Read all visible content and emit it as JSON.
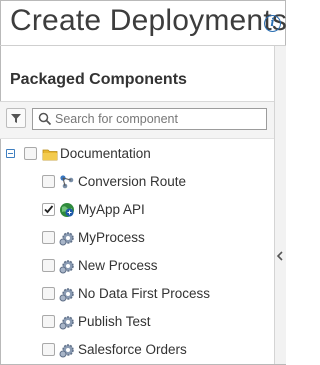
{
  "header": {
    "title": "Create Deployments",
    "info_icon": "info-icon"
  },
  "panel": {
    "section_title": "Packaged Components",
    "search": {
      "placeholder": "Search for component",
      "value": ""
    },
    "filter_icon": "filter-icon",
    "search_icon": "search-icon",
    "collapse_icon": "chevron-left-icon"
  },
  "tree": {
    "folder": {
      "label": "Documentation",
      "expanded": true,
      "checked": false,
      "icon": "folder-icon"
    },
    "items": [
      {
        "label": "Conversion Route",
        "checked": false,
        "icon": "route-icon"
      },
      {
        "label": "MyApp API",
        "checked": true,
        "icon": "api-globe-icon"
      },
      {
        "label": "MyProcess",
        "checked": false,
        "icon": "process-gear-icon"
      },
      {
        "label": "New Process",
        "checked": false,
        "icon": "process-gear-icon"
      },
      {
        "label": "No Data First Process",
        "checked": false,
        "icon": "process-gear-icon"
      },
      {
        "label": "Publish Test",
        "checked": false,
        "icon": "process-gear-icon"
      },
      {
        "label": "Salesforce Orders",
        "checked": false,
        "icon": "process-gear-icon"
      }
    ]
  },
  "colors": {
    "accent": "#2b6fb3",
    "folder": "#e8b730",
    "check": "#222222"
  }
}
